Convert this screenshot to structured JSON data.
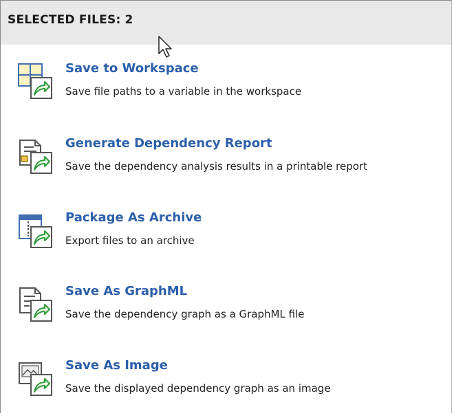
{
  "header": {
    "title": "SELECTED FILES: 2"
  },
  "actions": [
    {
      "title": "Save to Workspace",
      "description": "Save file paths to a variable in the workspace",
      "icon": "workspace-table-export-icon"
    },
    {
      "title": "Generate Dependency Report",
      "description": "Save the dependency analysis results in a printable report",
      "icon": "report-export-icon"
    },
    {
      "title": "Package As Archive",
      "description": "Export files to an archive",
      "icon": "archive-export-icon"
    },
    {
      "title": "Save As GraphML",
      "description": "Save the dependency graph as a GraphML file",
      "icon": "graphml-export-icon"
    },
    {
      "title": "Save As Image",
      "description": "Save the displayed dependency graph as an image",
      "icon": "image-export-icon"
    }
  ],
  "colors": {
    "link": "#2b5fab",
    "header_bg": "#e9e9e9",
    "export_arrow": "#2e9a3a"
  }
}
